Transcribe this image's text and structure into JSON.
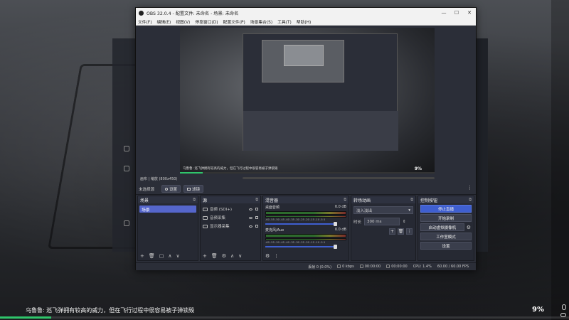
{
  "game": {
    "status_text": "乌鲁鲁: 巡飞弹拥有较高的威力，但在飞行过程中很容易被子弹锁毁",
    "progress_pct": "9%",
    "progress_fraction": 0.09
  },
  "window": {
    "title": "OBS 32.0.4 - 配置文件: 未命名 - 场景: 未命名",
    "menu": [
      "文件(F)",
      "编辑(E)",
      "视图(V)",
      "停靠窗口(D)",
      "配置文件(P)",
      "场景集合(S)",
      "工具(T)",
      "帮助(H)"
    ]
  },
  "preview": {
    "game_text": "乌鲁鲁: 巡飞弹拥有较高的威力，但在飞行过程中很容易被子弹锁毁",
    "pct": "9%",
    "status_line": "画布  |  缩放 (800x450)"
  },
  "source_toolbar": {
    "no_source": "未选择源",
    "settings": "设置",
    "filters": "滤镜"
  },
  "scenes": {
    "title": "场景",
    "items": [
      "场景"
    ]
  },
  "sources": {
    "title": "源",
    "items": [
      {
        "name": "音频 (SDI+)"
      },
      {
        "name": "音频采集"
      },
      {
        "name": "显示器采集"
      }
    ]
  },
  "mixer": {
    "title": "混音器",
    "channels": [
      {
        "name": "桌面音频",
        "db": "0.0 dB"
      },
      {
        "name": "麦克风/Aux",
        "db": "0.0 dB"
      }
    ],
    "scale": "-60 -55 -50 -45 -40 -35 -30 -25 -20 -15 -10 -5 0"
  },
  "transitions": {
    "title": "转场动画",
    "selected": "淡入淡出",
    "duration_label": "时长",
    "duration_value": "300 ms"
  },
  "controls": {
    "title": "控制按钮",
    "stream": "停止直播",
    "record": "开始录制",
    "virtual_cam": "启动虚拟摄像机",
    "studio": "工作室模式",
    "settings": "设置"
  },
  "statusbar": {
    "dropped": "丢帧 0 (0.0%)",
    "kbps": "0 kbps",
    "rec_time": "00:00:00",
    "stream_time": "00:00:00",
    "cpu": "CPU: 1.4%",
    "fps": "60.00 / 60.00 FPS"
  },
  "colors": {
    "accent": "#3f5fd0",
    "progress": "#2fc56b",
    "panel": "#2b2e38"
  }
}
